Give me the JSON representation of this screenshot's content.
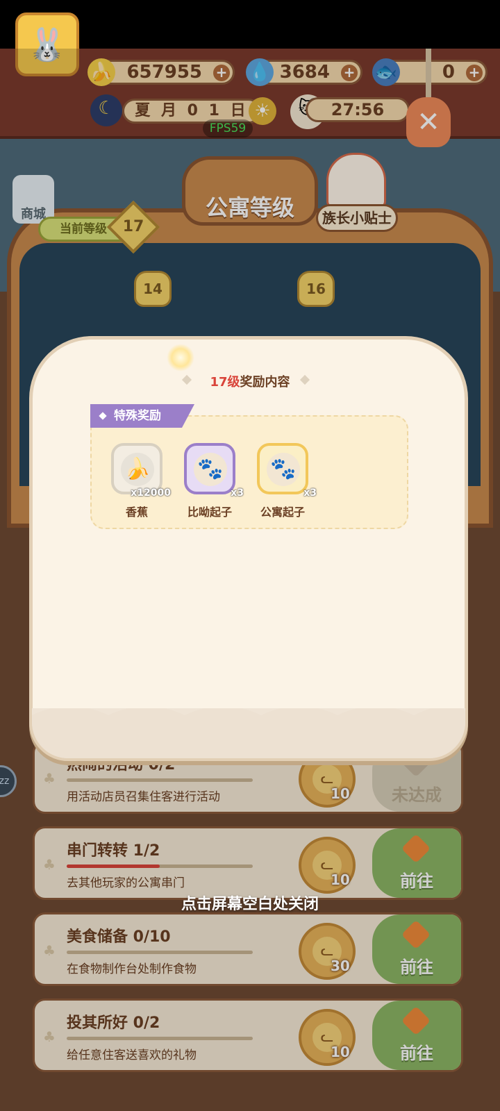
{
  "resources": {
    "banana": {
      "value": "657955",
      "icon": "banana-icon"
    },
    "flame": {
      "value": "3684",
      "icon": "flame-icon"
    },
    "fish": {
      "value": "0",
      "icon": "fish-icon"
    },
    "plus": "+"
  },
  "calendar": {
    "date": "夏 月 0 1 日",
    "time": "27:56"
  },
  "fps": "FPS59",
  "board": {
    "title": "公寓等级",
    "current_level_label": "当前等级",
    "current_level": "17",
    "tips_label": "族长小贴士",
    "shop_label": "商城",
    "nodes": [
      "14",
      "16"
    ]
  },
  "modal": {
    "level_text": "17级",
    "title_suffix": "奖励内容",
    "special_label": "特殊奖励",
    "items": [
      {
        "name": "香蕉",
        "qty": "x12000",
        "icon": "banana-icon",
        "frame": "#d8d0c0"
      },
      {
        "name": "比呦起子",
        "qty": "x3",
        "icon": "paw-key-icon",
        "frame": "#9b7fc9"
      },
      {
        "name": "公寓起子",
        "qty": "x3",
        "icon": "paw-key-icon",
        "frame": "#f2c75a"
      }
    ]
  },
  "close_hint": "点击屏幕空白处关闭",
  "tasks": [
    {
      "title": "热闹的活动 0/2",
      "desc": "用活动店员召集住客进行活动",
      "reward": "10",
      "action": "未达成",
      "progress": 0
    },
    {
      "title": "串门转转 1/2",
      "desc": "去其他玩家的公寓串门",
      "reward": "10",
      "action": "前往",
      "progress": 0.5
    },
    {
      "title": "美食储备 0/10",
      "desc": "在食物制作台处制作食物",
      "reward": "30",
      "action": "前往",
      "progress": 0
    },
    {
      "title": "投其所好 0/2",
      "desc": "给任意住客送喜欢的礼物",
      "reward": "10",
      "action": "前往",
      "progress": 0
    }
  ],
  "colors": {
    "accent_red": "#d9443a",
    "go_green": "#8cb565",
    "special_purple": "#9b7fc9"
  }
}
